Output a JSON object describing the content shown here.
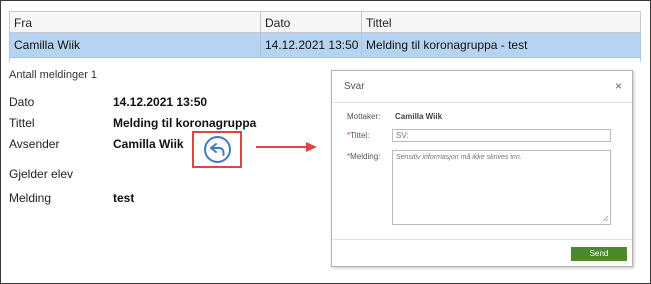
{
  "table": {
    "headers": [
      "Fra",
      "Dato",
      "Tittel"
    ],
    "rows": [
      [
        "Camilla Wiik",
        "14.12.2021 13:50",
        "Melding til koronagruppa - test"
      ]
    ]
  },
  "message_count_label": "Antall meldinger 1",
  "details": {
    "date_label": "Dato",
    "date_value": "14.12.2021 13:50",
    "title_label": "Tittel",
    "title_value": "Melding til koronagruppa",
    "sender_label": "Avsender",
    "sender_value": "Camilla Wiik",
    "student_label": "Gjelder elev",
    "message_label": "Melding",
    "message_value": "test"
  },
  "reply_icon": "reply-arrow-icon",
  "dialog": {
    "title": "Svar",
    "close_glyph": "×",
    "recipient_label": "Mottaker:",
    "recipient_value": "Camilla Wiik",
    "title_field_label": "Tittel:",
    "title_field_value": "SV:",
    "message_field_label": "Melding:",
    "message_field_placeholder": "Sensitiv informasjon må ikke skrives inn.",
    "required_mark": "*",
    "send_label": "Send"
  },
  "colors": {
    "selected_row": "#b6d4f2",
    "highlight_border": "#e04545",
    "reply_icon": "#3d7cc2",
    "send_button": "#4a8a2a",
    "arrow": "#e04545"
  }
}
